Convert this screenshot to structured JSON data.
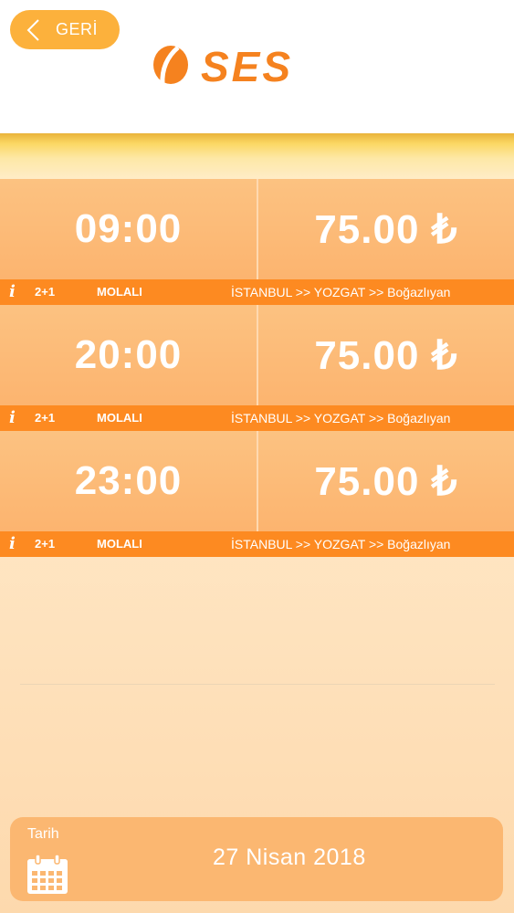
{
  "header": {
    "back_label": "GERİ",
    "logo_text": "SES",
    "back_icon": "chevron-left-icon"
  },
  "trips": [
    {
      "time": "09:00",
      "price": "75.00 ₺",
      "layout": "2+1",
      "stop_type": "MOLALI",
      "route": "İSTANBUL >> YOZGAT >> Boğazlıyan"
    },
    {
      "time": "20:00",
      "price": "75.00 ₺",
      "layout": "2+1",
      "stop_type": "MOLALI",
      "route": "İSTANBUL >> YOZGAT >> Boğazlıyan"
    },
    {
      "time": "23:00",
      "price": "75.00 ₺",
      "layout": "2+1",
      "stop_type": "MOLALI",
      "route": "İSTANBUL >> YOZGAT >> Boğazlıyan"
    }
  ],
  "info_icon_glyph": "i",
  "date": {
    "label": "Tarih",
    "value": "27 Nisan 2018",
    "icon": "calendar-icon"
  },
  "colors": {
    "accent": "#fd8a21",
    "button": "#fcb13c",
    "row": "#fcb46f",
    "logo": "#f5821f"
  }
}
